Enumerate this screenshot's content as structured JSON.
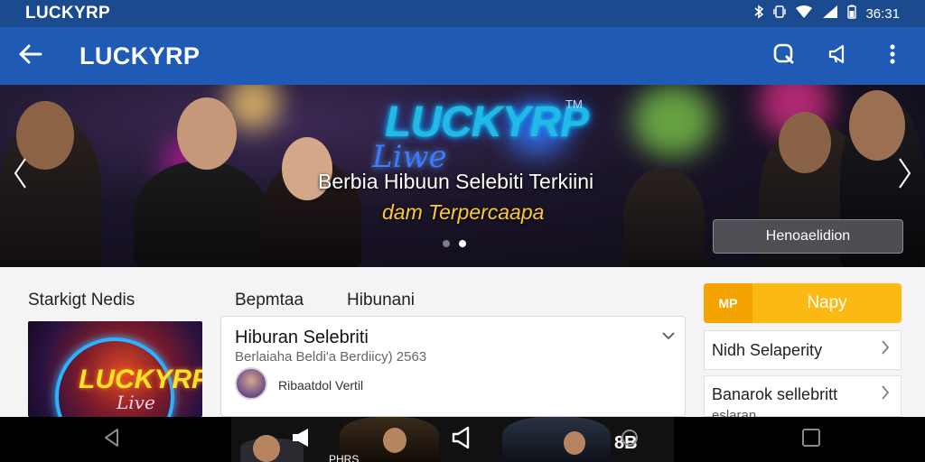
{
  "status_bar": {
    "app_name": "LUCKYRP",
    "time": "36:31",
    "icons": [
      "bluetooth-icon",
      "vibrate-icon",
      "wifi-icon",
      "signal-icon",
      "battery-icon"
    ]
  },
  "app_bar": {
    "title": "LUCKYRP",
    "icons": [
      "back-arrow-icon",
      "search-icon",
      "share-icon",
      "more-vert-icon"
    ]
  },
  "hero": {
    "logo_text": "LUCKYRP",
    "logo_tm": "TM",
    "logo_script": "Liwe",
    "subtitle_line1": "Berbia Hibuun Selebiti Terkiini",
    "subtitle_line2": "dam Terpercaapa",
    "button_label": "Henoaelidion",
    "dots_total": 2,
    "dots_active_index": 1,
    "accent_colors": {
      "logo": "#23b8e6",
      "subtitle2": "#ffc832"
    }
  },
  "content": {
    "section_left_title": "Starkigt  Nedis",
    "section_mid_titles": [
      "Bepmtaa",
      "Hibunani"
    ],
    "thumb_logo": "LUCKYRP",
    "thumb_script": "Live",
    "card": {
      "title": "Hiburan Selebriti",
      "meta": "Berlaiaha Beldi'a Berdiicy) 2563",
      "author": "Ribaatdol Vertil"
    },
    "sidebar": {
      "badge": "MP",
      "header_label": "Napy",
      "items": [
        {
          "label": "Nidh Selaperity",
          "sub": ""
        },
        {
          "label": "Banarok sellebritt",
          "sub": "eslaran"
        }
      ]
    },
    "colors": {
      "sidebar_header": "#fdb913",
      "sidebar_badge": "#f4a300"
    }
  },
  "nav_bar": {
    "icons": [
      "nav-back-icon",
      "cast-icon",
      "volume-icon",
      "nav-home-icon",
      "nav-recents-icon"
    ],
    "strip_text": "PHRS",
    "strip_badge": "8B"
  }
}
